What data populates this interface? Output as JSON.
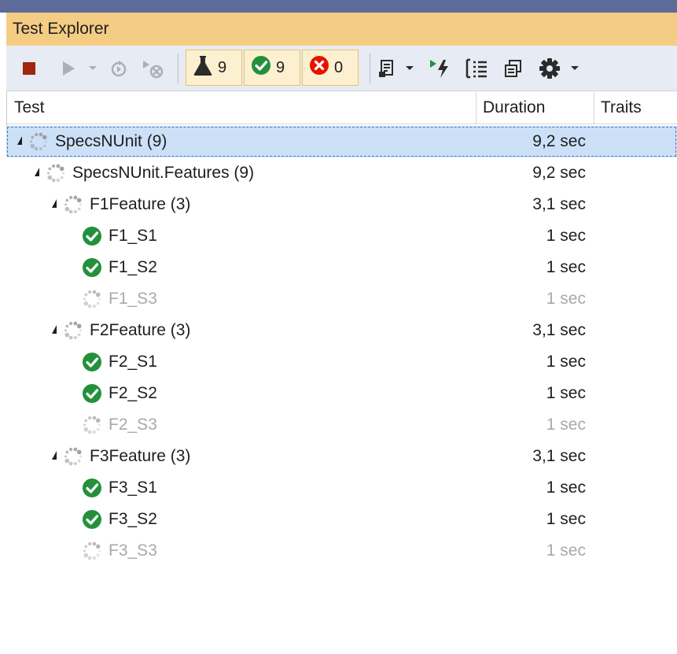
{
  "window": {
    "title": "Test Explorer"
  },
  "toolbar": {
    "counts": {
      "total": "9",
      "passed": "9",
      "failed": "0"
    },
    "icons": [
      "stop-icon",
      "run-icon",
      "dropdown-icon",
      "rerun-icon",
      "cancel-icon",
      "flask-icon",
      "passed-icon",
      "failed-icon",
      "playlist-icon",
      "run-failed-icon",
      "hierarchy-icon",
      "copy-icon",
      "settings-icon"
    ]
  },
  "columns": {
    "test": "Test",
    "duration": "Duration",
    "traits": "Traits"
  },
  "tree": [
    {
      "name": "SpecsNUnit (9)",
      "duration": "9,2 sec",
      "level": 0,
      "status": "running",
      "expandable": true,
      "selected": true
    },
    {
      "name": "SpecsNUnit.Features (9)",
      "duration": "9,2 sec",
      "level": 1,
      "status": "running",
      "expandable": true
    },
    {
      "name": "F1Feature (3)",
      "duration": "3,1 sec",
      "level": 2,
      "status": "running",
      "expandable": true
    },
    {
      "name": "F1_S1",
      "duration": "1 sec",
      "level": 3,
      "status": "passed"
    },
    {
      "name": "F1_S2",
      "duration": "1 sec",
      "level": 3,
      "status": "passed"
    },
    {
      "name": "F1_S3",
      "duration": "1 sec",
      "level": 3,
      "status": "pending"
    },
    {
      "name": "F2Feature (3)",
      "duration": "3,1 sec",
      "level": 2,
      "status": "running",
      "expandable": true
    },
    {
      "name": "F2_S1",
      "duration": "1 sec",
      "level": 3,
      "status": "passed"
    },
    {
      "name": "F2_S2",
      "duration": "1 sec",
      "level": 3,
      "status": "passed"
    },
    {
      "name": "F2_S3",
      "duration": "1 sec",
      "level": 3,
      "status": "pending"
    },
    {
      "name": "F3Feature (3)",
      "duration": "3,1 sec",
      "level": 2,
      "status": "running",
      "expandable": true
    },
    {
      "name": "F3_S1",
      "duration": "1 sec",
      "level": 3,
      "status": "passed"
    },
    {
      "name": "F3_S2",
      "duration": "1 sec",
      "level": 3,
      "status": "passed"
    },
    {
      "name": "F3_S3",
      "duration": "1 sec",
      "level": 3,
      "status": "pending"
    }
  ],
  "colors": {
    "titlebar": "#f5cc84",
    "passed": "#23913b",
    "failed": "#e51400",
    "stop": "#a1260d",
    "selection": "#cce1f7"
  }
}
